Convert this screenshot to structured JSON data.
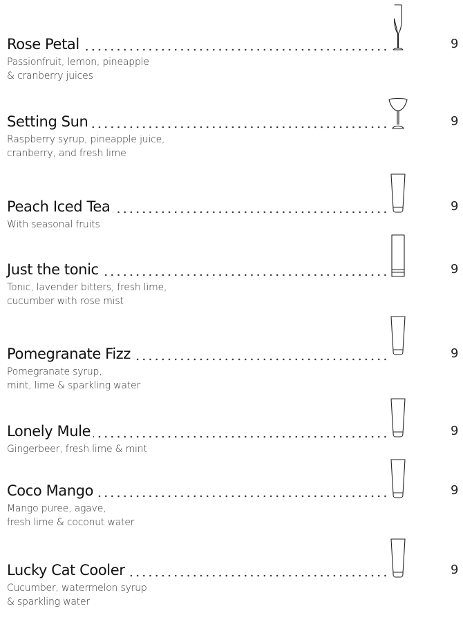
{
  "menu": {
    "items": [
      {
        "name": "Rose Petal",
        "desc": [
          "Passionfruit, lemon, pineapple",
          "& cranberry juices"
        ],
        "price": "9",
        "glass": "champagne-flute-icon"
      },
      {
        "name": "Setting Sun",
        "desc": [
          "Raspberry syrup, pineapple juice,",
          "cranberry, and fresh lime"
        ],
        "price": "9",
        "glass": "coupe-glass-icon"
      },
      {
        "name": "Peach Iced Tea",
        "desc": [
          "With seasonal fruits"
        ],
        "price": "9",
        "glass": "highball-glass-icon"
      },
      {
        "name": "Just the tonic",
        "desc": [
          "Tonic, lavender bitters, fresh lime,",
          "cucumber with rose mist"
        ],
        "price": "9",
        "glass": "collins-glass-icon"
      },
      {
        "name": "Pomegranate Fizz",
        "desc": [
          "Pomegranate syrup,",
          "mint, lime & sparkling water"
        ],
        "price": "9",
        "glass": "highball-glass-icon"
      },
      {
        "name": "Lonely Mule",
        "desc": [
          "Gingerbeer, fresh lime & mint"
        ],
        "price": "9",
        "glass": "highball-glass-icon"
      },
      {
        "name": "Coco Mango",
        "desc": [
          "Mango puree, agave,",
          "fresh lime & coconut water"
        ],
        "price": "9",
        "glass": "highball-glass-icon"
      },
      {
        "name": "Lucky Cat Cooler",
        "desc": [
          "Cucumber, watermelon syrup",
          "& sparkling water"
        ],
        "price": "9",
        "glass": "highball-glass-icon"
      }
    ]
  }
}
